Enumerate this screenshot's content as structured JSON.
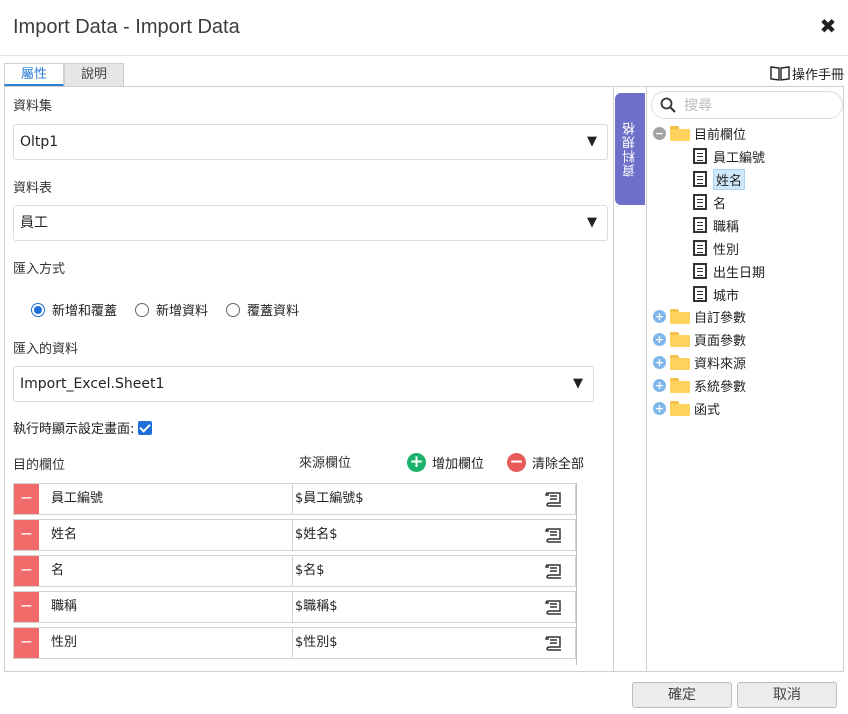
{
  "window": {
    "title": "Import Data - Import Data",
    "close_icon": "close-icon"
  },
  "tabs": [
    {
      "label": "屬性",
      "active": true
    },
    {
      "label": "說明",
      "active": false
    }
  ],
  "manual": {
    "label": "操作手冊",
    "icon": "book-icon"
  },
  "form": {
    "dataset_label": "資料集",
    "dataset_value": "Oltp1",
    "table_label": "資料表",
    "table_value": "員工",
    "mode_label": "匯入方式",
    "mode_options": [
      {
        "label": "新增和覆蓋",
        "checked": true
      },
      {
        "label": "新增資料",
        "checked": false
      },
      {
        "label": "覆蓋資料",
        "checked": false
      }
    ],
    "import_label": "匯入的資料",
    "import_value": "Import_Excel.Sheet1",
    "show_setting_label": "執行時顯示設定畫面:",
    "show_setting_checked": true
  },
  "mapping": {
    "target_header": "目的欄位",
    "source_header": "來源欄位",
    "add_label": "增加欄位",
    "clear_label": "清除全部",
    "rows": [
      {
        "minus": "−",
        "target": "員工編號",
        "source": "$員工編號$"
      },
      {
        "minus": "−",
        "target": "姓名",
        "source": "$姓名$"
      },
      {
        "minus": "−",
        "target": "名",
        "source": "$名$"
      },
      {
        "minus": "−",
        "target": "職稱",
        "source": "$職稱$"
      },
      {
        "minus": "−",
        "target": "性別",
        "source": "$性別$"
      }
    ]
  },
  "side_tab": {
    "label": "資料規格"
  },
  "tree": {
    "search_placeholder": "搜尋",
    "current_fields": {
      "label": "目前欄位",
      "children": [
        "員工編號",
        "姓名",
        "名",
        "職稱",
        "性別",
        "出生日期",
        "城市"
      ],
      "selected": "姓名"
    },
    "groups": [
      "自訂參數",
      "頁面參數",
      "資料來源",
      "系統參數",
      "函式"
    ]
  },
  "footer": {
    "ok": "確定",
    "cancel": "取消"
  },
  "colors": {
    "accent": "#2a7fd4",
    "sidetab": "#6c70c9",
    "remove": "#f36a6a",
    "add": "#1ab26b"
  }
}
